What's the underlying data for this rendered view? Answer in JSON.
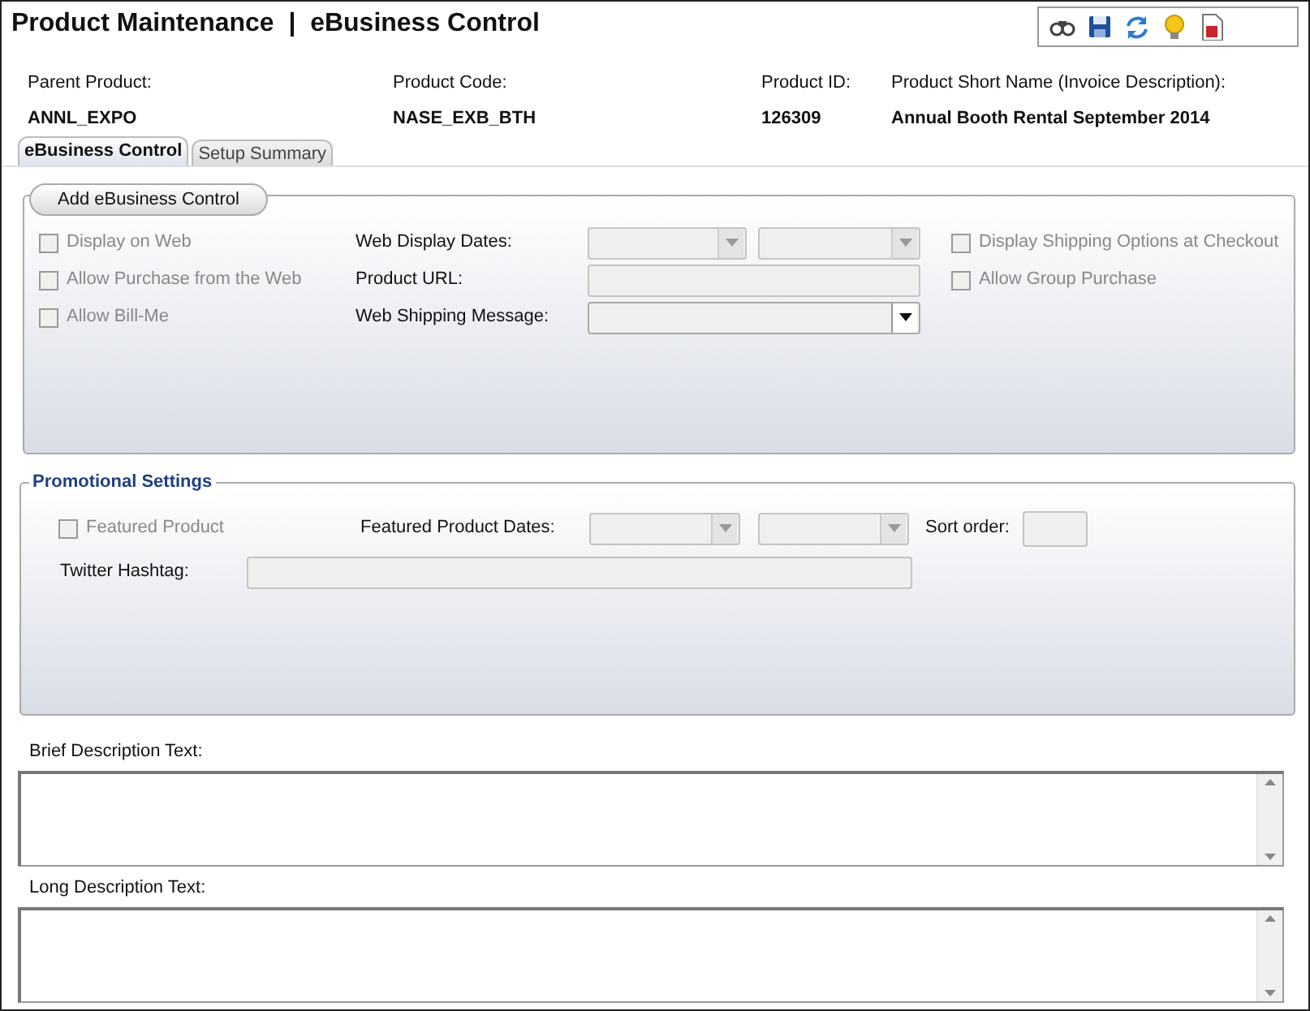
{
  "title": "Product Maintenance  |  eBusiness Control",
  "toolbar": [
    {
      "kind": "binoculars"
    },
    {
      "kind": "save"
    },
    {
      "kind": "refresh"
    },
    {
      "kind": "bulb"
    },
    {
      "kind": "report"
    }
  ],
  "info": [
    {
      "label": "Parent Product:",
      "value": "ANNL_EXPO"
    },
    {
      "label": "Product Code:",
      "value": "NASE_EXB_BTH"
    },
    {
      "label": "Product ID:",
      "value": "126309"
    },
    {
      "label": "Product Short Name (Invoice Description):",
      "value": "Annual Booth Rental September 2014"
    }
  ],
  "tabs": [
    {
      "label": "eBusiness Control",
      "selected": true
    },
    {
      "label": "Setup Summary",
      "selected": false
    }
  ],
  "ebusiness": {
    "button": "Add eBusiness Control",
    "left_checks": [
      {
        "label": "Display on Web",
        "checked": false,
        "disabled": true
      },
      {
        "label": "Allow Purchase from the Web",
        "checked": false,
        "disabled": true
      },
      {
        "label": "Allow Bill-Me",
        "checked": false,
        "disabled": true
      }
    ],
    "fields": [
      {
        "label": "Web Display Dates:",
        "kind": "date_pair",
        "disabled": true
      },
      {
        "label": "Product URL:",
        "kind": "text",
        "disabled": true
      },
      {
        "label": "Web Shipping Message:",
        "kind": "dropdown",
        "disabled": false
      }
    ],
    "right_checks": [
      {
        "label": "Display Shipping Options at Checkout",
        "checked": false,
        "disabled": true
      },
      {
        "label": "Allow Group Purchase",
        "checked": false,
        "disabled": true
      }
    ]
  },
  "promotional": {
    "legend": "Promotional Settings",
    "featured": {
      "label": "Featured Product",
      "checked": false,
      "disabled": true
    },
    "dates_label": "Featured Product Dates:",
    "sort_label": "Sort order:",
    "hashtag_label": "Twitter Hashtag:"
  },
  "descriptions": [
    {
      "label": "Brief Description Text:"
    },
    {
      "label": "Long Description Text:"
    }
  ]
}
